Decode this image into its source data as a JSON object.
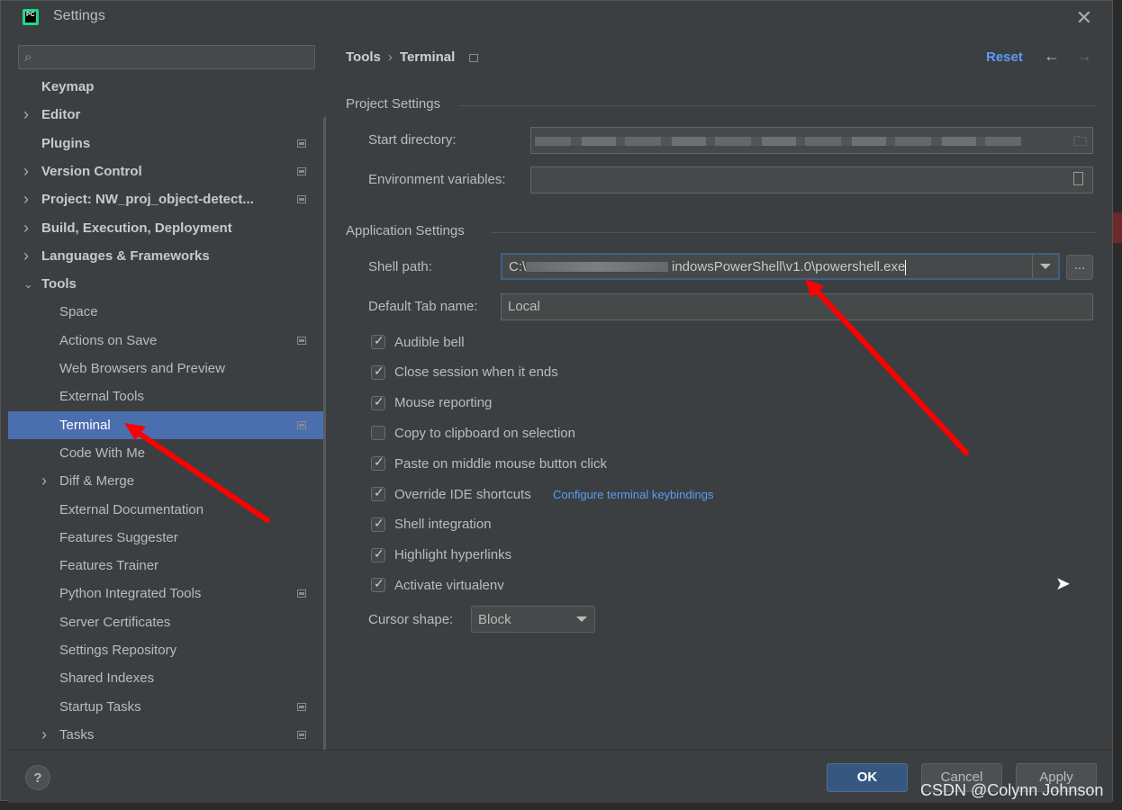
{
  "window": {
    "title": "Settings",
    "logo": "PC"
  },
  "sidebar": {
    "search_placeholder": "",
    "items": [
      {
        "label": "Keymap",
        "level": "top",
        "expander": "none"
      },
      {
        "label": "Editor",
        "level": "top",
        "expander": "right"
      },
      {
        "label": "Plugins",
        "level": "top",
        "expander": "none",
        "project_icon": true
      },
      {
        "label": "Version Control",
        "level": "top",
        "expander": "right",
        "project_icon": true
      },
      {
        "label": "Project: NW_proj_object-detect...",
        "level": "top",
        "expander": "right",
        "project_icon": true
      },
      {
        "label": "Build, Execution, Deployment",
        "level": "top",
        "expander": "right"
      },
      {
        "label": "Languages & Frameworks",
        "level": "top",
        "expander": "right"
      },
      {
        "label": "Tools",
        "level": "top",
        "expander": "down"
      },
      {
        "label": "Space",
        "level": "child",
        "expander": "none"
      },
      {
        "label": "Actions on Save",
        "level": "child",
        "expander": "none",
        "project_icon": true
      },
      {
        "label": "Web Browsers and Preview",
        "level": "child",
        "expander": "none"
      },
      {
        "label": "External Tools",
        "level": "child",
        "expander": "none"
      },
      {
        "label": "Terminal",
        "level": "child",
        "expander": "none",
        "project_icon": true,
        "selected": true
      },
      {
        "label": "Code With Me",
        "level": "child",
        "expander": "none"
      },
      {
        "label": "Diff & Merge",
        "level": "child",
        "expander": "right"
      },
      {
        "label": "External Documentation",
        "level": "child",
        "expander": "none"
      },
      {
        "label": "Features Suggester",
        "level": "child",
        "expander": "none"
      },
      {
        "label": "Features Trainer",
        "level": "child",
        "expander": "none"
      },
      {
        "label": "Python Integrated Tools",
        "level": "child",
        "expander": "none",
        "project_icon": true
      },
      {
        "label": "Server Certificates",
        "level": "child",
        "expander": "none"
      },
      {
        "label": "Settings Repository",
        "level": "child",
        "expander": "none"
      },
      {
        "label": "Shared Indexes",
        "level": "child",
        "expander": "none"
      },
      {
        "label": "Startup Tasks",
        "level": "child",
        "expander": "none",
        "project_icon": true
      },
      {
        "label": "Tasks",
        "level": "child",
        "expander": "right",
        "project_icon": true
      }
    ]
  },
  "main": {
    "breadcrumb": {
      "parent": "Tools",
      "separator": "›",
      "current": "Terminal"
    },
    "reset_label": "Reset",
    "project_settings": {
      "title": "Project Settings",
      "start_directory_label": "Start directory:",
      "environment_variables_label": "Environment variables:"
    },
    "application_settings": {
      "title": "Application Settings",
      "shell_path_label": "Shell path:",
      "shell_path_prefix": "C:\\",
      "shell_path_suffix": "indowsPowerShell\\v1.0\\powershell.exe",
      "more_button": "...",
      "default_tab_label": "Default Tab name:",
      "default_tab_value": "Local",
      "checkboxes": [
        {
          "label": "Audible bell",
          "checked": true
        },
        {
          "label": "Close session when it ends",
          "checked": true
        },
        {
          "label": "Mouse reporting",
          "checked": true
        },
        {
          "label": "Copy to clipboard on selection",
          "checked": false
        },
        {
          "label": "Paste on middle mouse button click",
          "checked": true
        },
        {
          "label": "Override IDE shortcuts",
          "checked": true
        },
        {
          "label": "Shell integration",
          "checked": true
        },
        {
          "label": "Highlight hyperlinks",
          "checked": true
        },
        {
          "label": "Activate virtualenv",
          "checked": true
        }
      ],
      "keybindings_link": "Configure terminal keybindings",
      "cursor_shape_label": "Cursor shape:",
      "cursor_shape_value": "Block"
    }
  },
  "footer": {
    "help": "?",
    "ok": "OK",
    "cancel": "Cancel",
    "apply": "Apply"
  },
  "watermark": "CSDN @Colynn Johnson",
  "colors": {
    "accent": "#4b6eaf",
    "link": "#589df6",
    "annotation": "#ff0000"
  }
}
